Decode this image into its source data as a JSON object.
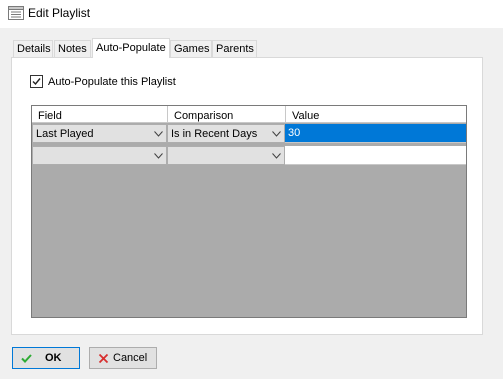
{
  "window": {
    "title": "Edit Playlist"
  },
  "tabs": [
    {
      "label": "Details"
    },
    {
      "label": "Notes"
    },
    {
      "label": "Auto-Populate",
      "active": true
    },
    {
      "label": "Games"
    },
    {
      "label": "Parents"
    }
  ],
  "auto_populate": {
    "checkbox_label": "Auto-Populate this Playlist",
    "checked": true
  },
  "grid": {
    "columns": [
      "Field",
      "Comparison",
      "Value"
    ],
    "rows": [
      {
        "field": "Last Played",
        "comparison": "Is in Recent Days",
        "value": "30",
        "selected": true
      },
      {
        "field": "",
        "comparison": "",
        "value": "",
        "selected": false
      }
    ]
  },
  "buttons": {
    "ok_label": "OK",
    "cancel_label": "Cancel"
  },
  "colors": {
    "accent": "#0078d7",
    "ok_icon": "#2eab34",
    "cancel_icon": "#d72e2e"
  }
}
